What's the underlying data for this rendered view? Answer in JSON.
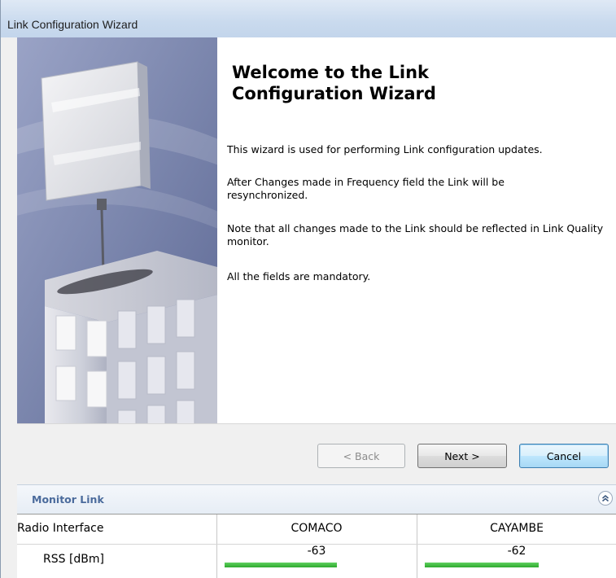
{
  "window": {
    "title": "Link Configuration Wizard"
  },
  "wizard": {
    "heading": "Welcome to the Link Configuration Wizard",
    "paragraphs": [
      "This wizard is used for performing Link configuration updates.",
      "After Changes made in Frequency field the Link will be resynchronized.",
      "Note that all changes made to the Link should be reflected in Link Quality monitor.",
      "All the fields are mandatory."
    ]
  },
  "buttons": {
    "back": "< Back",
    "next": "Next >",
    "cancel": "Cancel"
  },
  "monitor": {
    "title": "Monitor Link",
    "collapse_icon": "double-chevron-up-icon",
    "columns": [
      "Radio Interface",
      "COMACO",
      "CAYAMBE"
    ],
    "rows": [
      {
        "label": "RSS [dBm]",
        "values": [
          "-63",
          "-62"
        ]
      }
    ]
  },
  "colors": {
    "signal_bar": "#3cbf3c",
    "default_button_border": "#3c7fb1",
    "monitor_title": "#4b6b9c"
  }
}
